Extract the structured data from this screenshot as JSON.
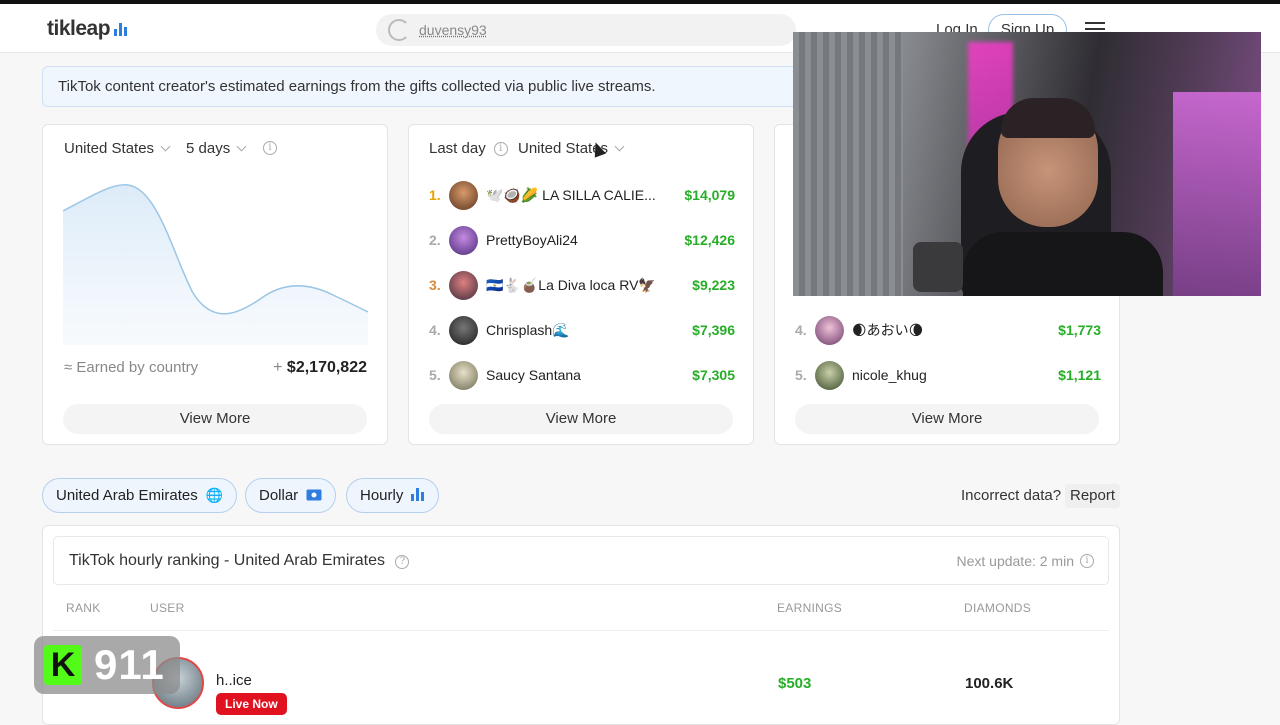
{
  "header": {
    "logo": "tikleap",
    "search_value": "duvensy93",
    "login_label": "Log In",
    "signup_label": "Sign Up"
  },
  "banner": {
    "text": "TikTok content creator's estimated earnings from the gifts collected via public live streams."
  },
  "card1": {
    "country_filter": "United States",
    "period_filter": "5 days",
    "earned_label": "≈ Earned by country",
    "earned_prefix": "+",
    "earned_value": "$2,170,822",
    "view_more": "View More"
  },
  "card2": {
    "period_filter": "Last day",
    "country_filter": "United States",
    "rows": [
      {
        "rank": "1.",
        "name": "🕊️🥥🌽 LA SILLA CALIE...",
        "amount": "$14,079"
      },
      {
        "rank": "2.",
        "name": "PrettyBoyAli24",
        "amount": "$12,426"
      },
      {
        "rank": "3.",
        "name": "🇸🇻🐇🧉La Diva loca RV🦅",
        "amount": "$9,223"
      },
      {
        "rank": "4.",
        "name": "Chrisplash🌊",
        "amount": "$7,396"
      },
      {
        "rank": "5.",
        "name": "Saucy Santana",
        "amount": "$7,305"
      }
    ],
    "view_more": "View More"
  },
  "card3": {
    "rows": [
      {
        "rank": "4.",
        "name": "🌒あおい🌘",
        "amount": "$1,773"
      },
      {
        "rank": "5.",
        "name": "nicole_khug",
        "amount": "$1,121"
      }
    ],
    "view_more": "View More"
  },
  "filters": {
    "country": "United Arab Emirates",
    "currency": "Dollar",
    "interval": "Hourly",
    "incorrect_label": "Incorrect data?",
    "report_label": "Report"
  },
  "ranking": {
    "title": "TikTok hourly ranking - United Arab Emirates",
    "next_update": "Next update: 2 min",
    "columns": {
      "rank": "RANK",
      "user": "USER",
      "earnings": "EARNINGS",
      "diamonds": "DIAMONDS"
    },
    "row": {
      "name": "h..ice",
      "live": "Live Now",
      "earnings": "$503",
      "diamonds": "100.6K"
    }
  },
  "overlay": {
    "kick_letter": "K",
    "kick_count": "911"
  },
  "colors": {
    "accent": "#2f7de1",
    "money": "#27ae27",
    "live": "#e0121f",
    "kick": "#53fc18"
  }
}
